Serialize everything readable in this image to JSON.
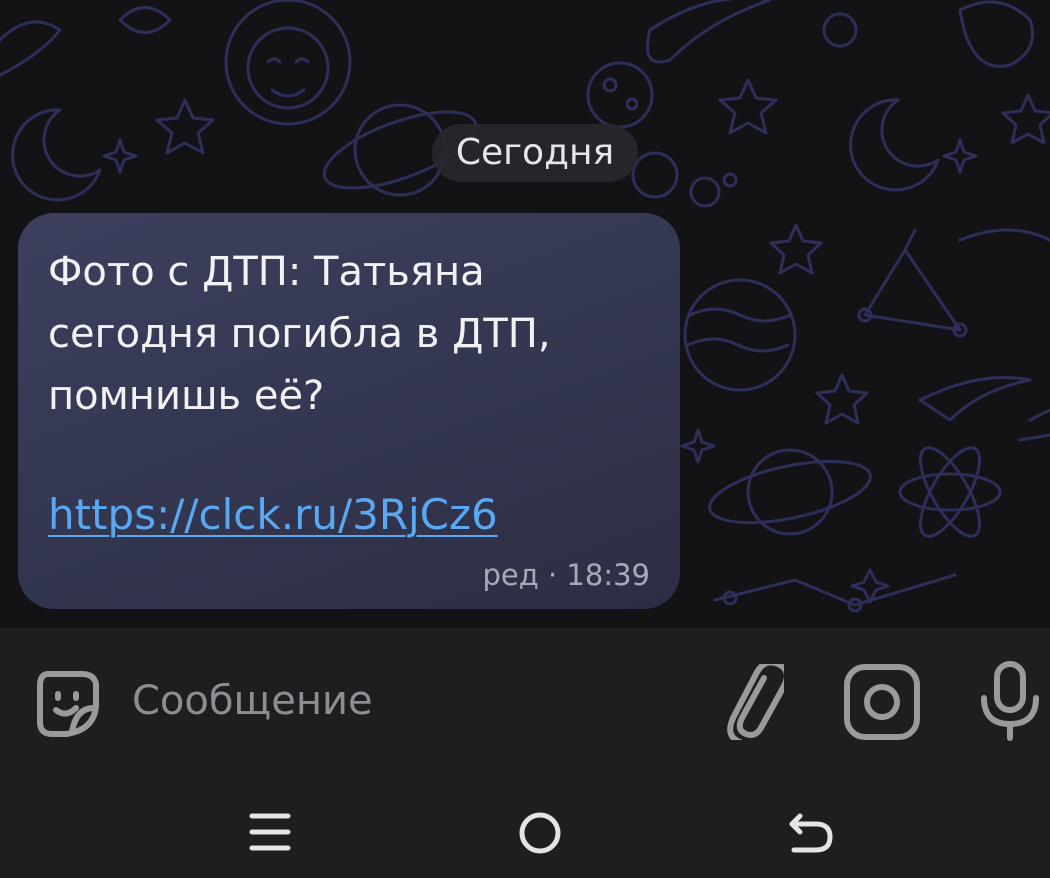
{
  "chat": {
    "date_label": "Сегодня",
    "message": {
      "text": "Фото с ДТП:  Татьяна\nсегодня погибла в ДТП,\nпомнишь её?",
      "link": "https://clck.ru/3RjCz6",
      "edited_label": "ред",
      "separator": "·",
      "time": "18:39"
    }
  },
  "composer": {
    "placeholder": "Сообщение",
    "icons": {
      "emoji": "sticker-emoji-icon",
      "attach": "paperclip-icon",
      "camera": "camera-icon",
      "voice": "microphone-icon"
    }
  },
  "navbar": {
    "icons": {
      "recents": "recent-apps-icon",
      "home": "home-icon",
      "back": "back-icon"
    }
  },
  "colors": {
    "chat_background": "#131316",
    "doodle_stroke": "#2e2e5a",
    "bubble": "#383b57",
    "link": "#5aa7f2",
    "composer_background": "#1e1e20",
    "icon_gray": "#9a9a9e"
  }
}
